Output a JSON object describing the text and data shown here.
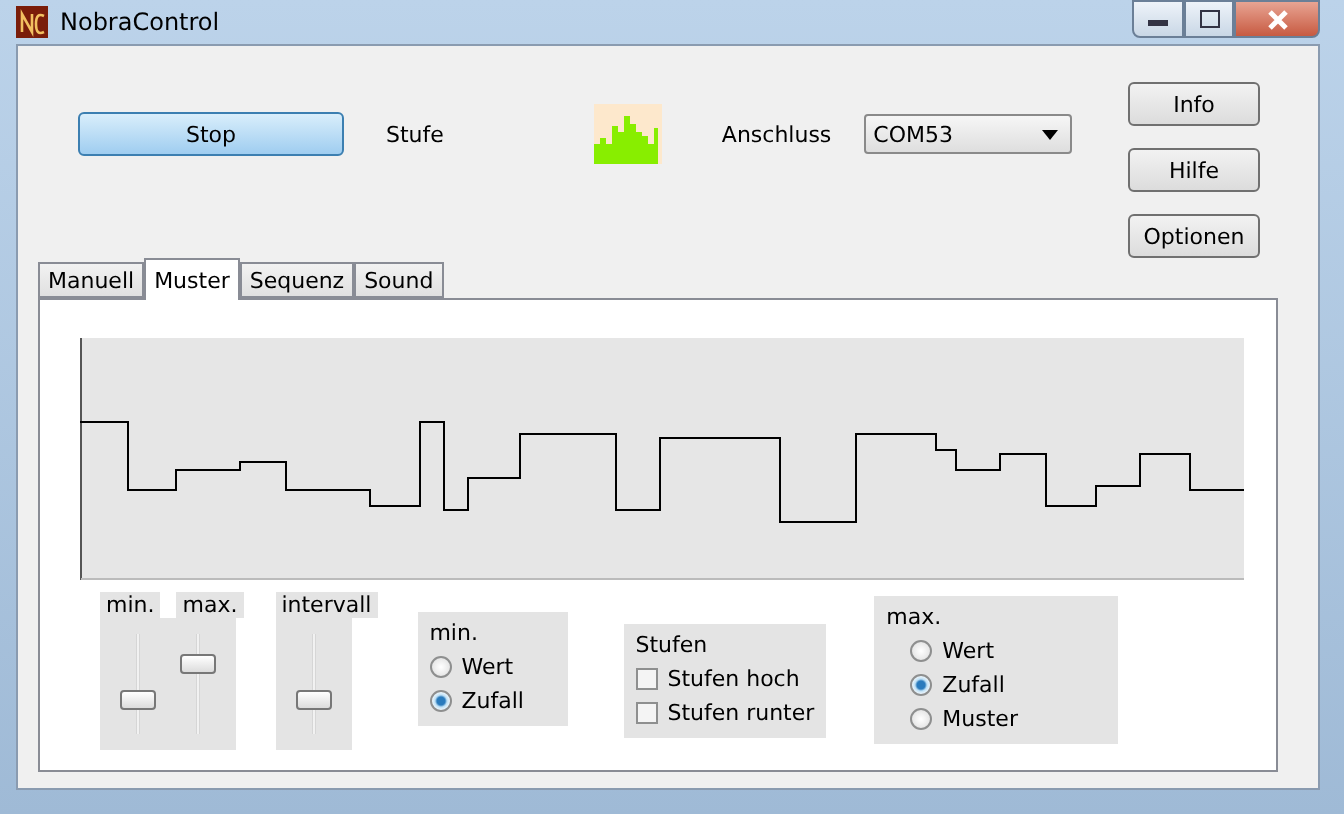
{
  "window": {
    "title": "NobraControl"
  },
  "top": {
    "stop_button": "Stop",
    "stufe_label": "Stufe",
    "anschluss_label": "Anschluss",
    "port": {
      "value": "COM53"
    }
  },
  "side_buttons": [
    "Info",
    "Hilfe",
    "Optionen"
  ],
  "tabs": [
    {
      "label": "Manuell",
      "selected": false
    },
    {
      "label": "Muster",
      "selected": true
    },
    {
      "label": "Sequenz",
      "selected": false
    },
    {
      "label": "Sound",
      "selected": false
    }
  ],
  "sliders": [
    {
      "label": "min.",
      "level": 0.3
    },
    {
      "label": "max.",
      "level": 0.75
    }
  ],
  "interval_slider": {
    "label": "intervall",
    "level": 0.3
  },
  "min_group": {
    "title": "min.",
    "options": [
      {
        "label": "Wert",
        "selected": false
      },
      {
        "label": "Zufall",
        "selected": true
      }
    ]
  },
  "stufen_group": {
    "title": "Stufen",
    "options": [
      {
        "label": "Stufen hoch",
        "checked": false
      },
      {
        "label": "Stufen runter",
        "checked": false
      }
    ]
  },
  "max_group": {
    "title": "max.",
    "options": [
      {
        "label": "Wert",
        "selected": false
      },
      {
        "label": "Zufall",
        "selected": true
      },
      {
        "label": "Muster",
        "selected": false
      }
    ]
  }
}
